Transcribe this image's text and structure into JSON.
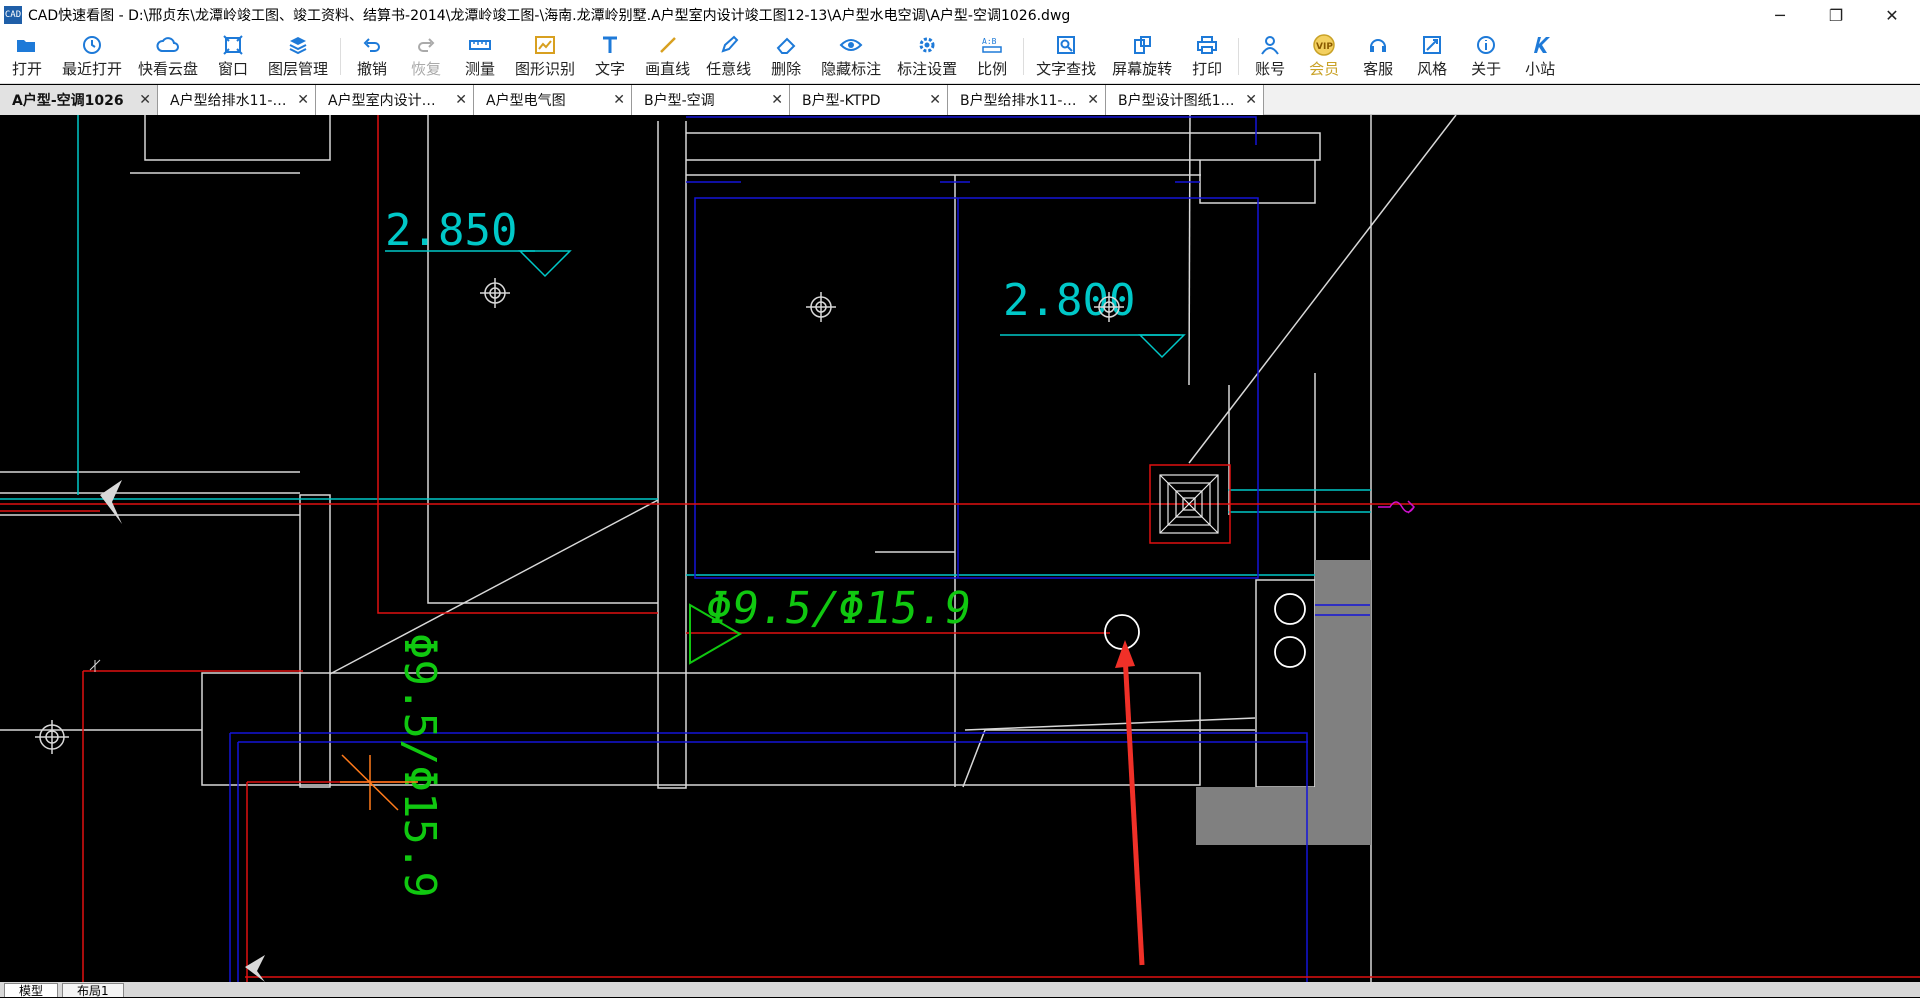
{
  "window": {
    "title": "CAD快速看图 - D:\\邢贞东\\龙潭岭竣工图、竣工资料、结算书-2014\\龙潭岭竣工图-\\海南.龙潭岭别墅.A户型室内设计竣工图12-13\\A户型水电空调\\A户型-空调1026.dwg",
    "app_icon_text": "CAD",
    "minimize": "─",
    "restore": "❐",
    "close": "✕"
  },
  "toolbar": {
    "items": [
      {
        "label": "打开",
        "icon": "folder-open-icon"
      },
      {
        "label": "最近打开",
        "icon": "clock-icon"
      },
      {
        "label": "快看云盘",
        "icon": "cloud-icon"
      },
      {
        "label": "窗口",
        "icon": "window-icon"
      },
      {
        "label": "图层管理",
        "icon": "layers-icon"
      },
      {
        "label": "撤销",
        "icon": "undo-icon"
      },
      {
        "label": "恢复",
        "icon": "redo-icon"
      },
      {
        "label": "测量",
        "icon": "ruler-icon"
      },
      {
        "label": "图形识别",
        "icon": "shape-recognize-icon"
      },
      {
        "label": "文字",
        "icon": "text-icon"
      },
      {
        "label": "画直线",
        "icon": "line-icon"
      },
      {
        "label": "任意线",
        "icon": "pen-icon"
      },
      {
        "label": "删除",
        "icon": "eraser-icon"
      },
      {
        "label": "隐藏标注",
        "icon": "eye-icon"
      },
      {
        "label": "标注设置",
        "icon": "gear-icon"
      },
      {
        "label": "比例",
        "icon": "scale-icon"
      },
      {
        "label": "文字查找",
        "icon": "text-search-icon"
      },
      {
        "label": "屏幕旋转",
        "icon": "rotate-icon"
      },
      {
        "label": "打印",
        "icon": "printer-icon"
      },
      {
        "label": "账号",
        "icon": "user-icon"
      },
      {
        "label": "会员",
        "icon": "vip-icon"
      },
      {
        "label": "客服",
        "icon": "headset-icon"
      },
      {
        "label": "风格",
        "icon": "style-icon"
      },
      {
        "label": "关于",
        "icon": "info-icon"
      },
      {
        "label": "小站",
        "icon": "k-logo-icon"
      }
    ]
  },
  "tabs": [
    {
      "label": "A户型-空调1026",
      "active": true
    },
    {
      "label": "A户型给排水11-…",
      "active": false
    },
    {
      "label": "A户型室内设计…",
      "active": false
    },
    {
      "label": "A户型电气图",
      "active": false
    },
    {
      "label": "B户型-空调",
      "active": false
    },
    {
      "label": "B户型-KTPD",
      "active": false
    },
    {
      "label": "B户型给排水11-…",
      "active": false
    },
    {
      "label": "B户型设计图纸1…",
      "active": false
    }
  ],
  "tab_close": "✕",
  "drawing": {
    "level_1": "2.850",
    "level_2": "2.800",
    "pipe_label_1": "Φ9.5/Φ15.9",
    "pipe_label_2": "Φ9.5/Φ15.9"
  },
  "bottom_tabs": [
    {
      "label": "模型",
      "active": true
    },
    {
      "label": "布局1",
      "active": false
    }
  ],
  "colors": {
    "cyan": "#00c8c8",
    "red": "#e01010",
    "blue": "#1414d8",
    "green": "#10c810",
    "magenta": "#d010d0",
    "orange": "#ff7a1a",
    "arrow_red": "#f03028",
    "gray_fill": "#808080"
  }
}
